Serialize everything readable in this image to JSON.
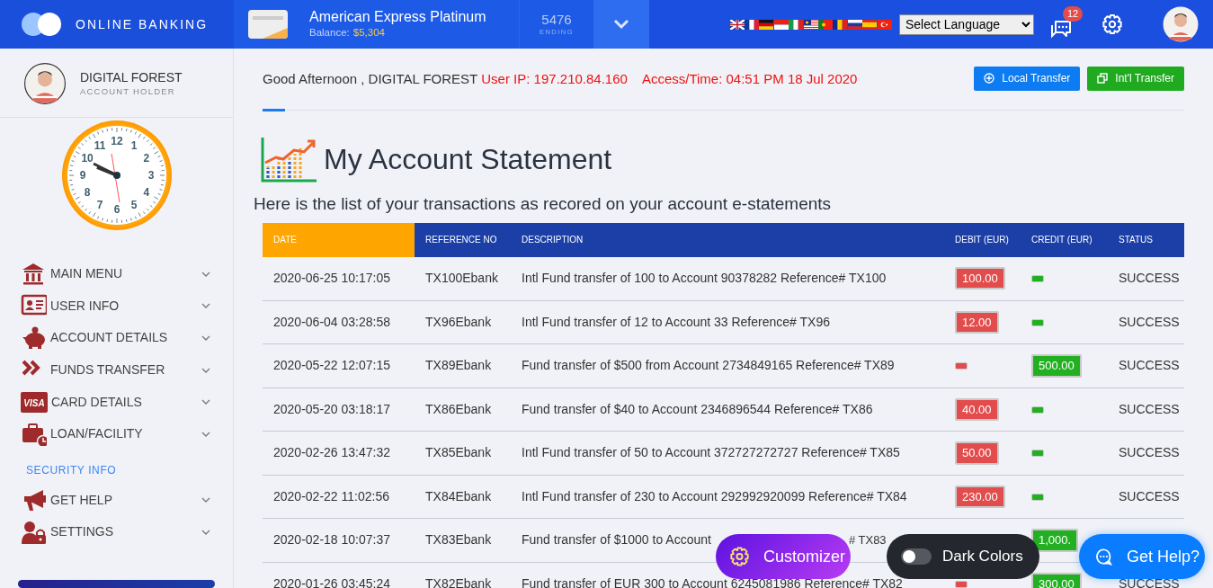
{
  "brand": {
    "name": "ONLINE BANKING"
  },
  "account": {
    "name": "American Express Platinum",
    "balance_label": "Balance:",
    "balance": "$5,304",
    "number": "5476",
    "number_label": "ENDING"
  },
  "languages": {
    "flags": [
      {
        "kind": "gb"
      },
      {
        "kind": "fr"
      },
      {
        "kind": "de"
      },
      {
        "kind": "id"
      },
      {
        "kind": "it"
      },
      {
        "kind": "my"
      },
      {
        "kind": "pt"
      },
      {
        "kind": "ro"
      },
      {
        "kind": "ru"
      },
      {
        "kind": "es"
      },
      {
        "kind": "tr"
      }
    ],
    "select_value": "Select Language"
  },
  "messages": {
    "count": "12"
  },
  "user": {
    "name": "DIGITAL FOREST",
    "role": "ACCOUNT HOLDER"
  },
  "clock": {
    "numerals": [
      "12",
      "11",
      "1",
      "10",
      "2",
      "9",
      "3",
      "8",
      "4",
      "7",
      "5",
      "6"
    ]
  },
  "menu": [
    {
      "items": [
        {
          "label": "MAIN MENU",
          "kind": "bank"
        },
        {
          "label": "USER INFO",
          "kind": "id"
        },
        {
          "label": "ACCOUNT DETAILS",
          "kind": "piggy"
        },
        {
          "label": "FUNDS TRANSFER",
          "kind": "chevrons"
        },
        {
          "label": "CARD DETAILS",
          "kind": "visa",
          "icon_text": "VISA"
        },
        {
          "label": "LOAN/FACILITY",
          "kind": "briefcase"
        }
      ]
    },
    {
      "heading": "SECURITY INFO",
      "items": [
        {
          "label": "GET HELP",
          "kind": "megaphone"
        },
        {
          "label": "SETTINGS",
          "kind": "userlock"
        }
      ]
    }
  ],
  "greeting": {
    "text": "Good Afternoon , DIGITAL FOREST",
    "ip": "User IP: 197.210.84.160",
    "access": "Access/Time: 04:51 PM 18 Jul 2020"
  },
  "actions": [
    {
      "label": "Local Transfer",
      "kind": "local"
    },
    {
      "label": "Int'l Transfer",
      "kind": "intl"
    }
  ],
  "statement": {
    "title": "My Account Statement",
    "subtitle": "Here is the list of your transactions as recored on your account e-statements"
  },
  "table": {
    "columns": [
      {
        "label": "DATE",
        "sorted": true
      },
      {
        "label": "REFERENCE NO",
        "sorted": false
      },
      {
        "label": "DESCRIPTION",
        "sorted": false
      },
      {
        "label": "DEBIT (EUR)",
        "sorted": false
      },
      {
        "label": "CREDIT (EUR)",
        "sorted": false
      },
      {
        "label": "STATUS",
        "sorted": false
      }
    ],
    "rows": [
      {
        "date": "2020-06-25 10:17:05",
        "reference": "TX100Ebank",
        "description": "Intl Fund transfer of 100 to Account 90378282 Reference# TX100",
        "debit": "100.00",
        "status": "SUCCESS"
      },
      {
        "date": "2020-06-04 03:28:58",
        "reference": "TX96Ebank",
        "description": "Intl Fund transfer of 12 to Account 33 Reference# TX96",
        "debit": "12.00",
        "status": "SUCCESS"
      },
      {
        "date": "2020-05-22 12:07:15",
        "reference": "TX89Ebank",
        "description": "Fund transfer of $500 from Account 2734849165 Reference# TX89",
        "credit": "500.00",
        "status": "SUCCESS"
      },
      {
        "date": "2020-05-20 03:18:17",
        "reference": "TX86Ebank",
        "description": "Fund transfer of $40 to Account 2346896544 Reference# TX86",
        "debit": "40.00",
        "status": "SUCCESS"
      },
      {
        "date": "2020-02-26 13:47:32",
        "reference": "TX85Ebank",
        "description": "Intl Fund transfer of 50 to Account 372727272727 Reference# TX85",
        "debit": "50.00",
        "status": "SUCCESS"
      },
      {
        "date": "2020-02-22 11:02:56",
        "reference": "TX84Ebank",
        "description": "Intl Fund transfer of 230 to Account 292992920099 Reference# TX84",
        "debit": "230.00",
        "status": "SUCCESS"
      },
      {
        "date": "2020-02-18 10:07:37",
        "reference": "TX83Ebank",
        "description": "Fund transfer of $1000 to Account",
        "description_tail": "# TX83",
        "credit": "1,000."
      },
      {
        "date": "2020-01-26 03:45:24",
        "reference": "TX82Ebank",
        "description": "Fund transfer of EUR 300 to Account 6245081986 Reference# TX82",
        "credit": "300.00",
        "status": "SUCCESS"
      }
    ]
  },
  "floating": {
    "customizer": "Customizer",
    "dark_colors": {
      "label": "Dark Colors",
      "on": false
    },
    "help": "Get Help?"
  }
}
